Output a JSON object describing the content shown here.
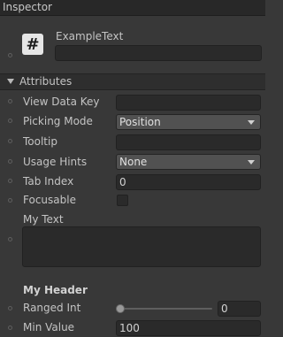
{
  "window": {
    "title": "Inspector"
  },
  "component": {
    "name": "ExampleText",
    "icon": "hash-icon",
    "name_value": ""
  },
  "attributes_section": {
    "label": "Attributes",
    "icon": "triangle-down-icon"
  },
  "fields": {
    "view_data_key": {
      "label": "View Data Key",
      "value": ""
    },
    "picking_mode": {
      "label": "Picking Mode",
      "value": "Position"
    },
    "tooltip": {
      "label": "Tooltip",
      "value": ""
    },
    "usage_hints": {
      "label": "Usage Hints",
      "value": "None"
    },
    "tab_index": {
      "label": "Tab Index",
      "value": "0"
    },
    "focusable": {
      "label": "Focusable",
      "checked": false
    },
    "my_text": {
      "label": "My Text",
      "value": ""
    },
    "my_header": {
      "label": "My Header"
    },
    "ranged_int": {
      "label": "Ranged Int",
      "value": "0",
      "slider_fraction": 0
    },
    "min_value": {
      "label": "Min Value",
      "value": "100"
    }
  },
  "colors": {
    "background": "#383838",
    "titlebar": "#282828",
    "field": "#2a2a2a",
    "dropdown": "#515151"
  }
}
